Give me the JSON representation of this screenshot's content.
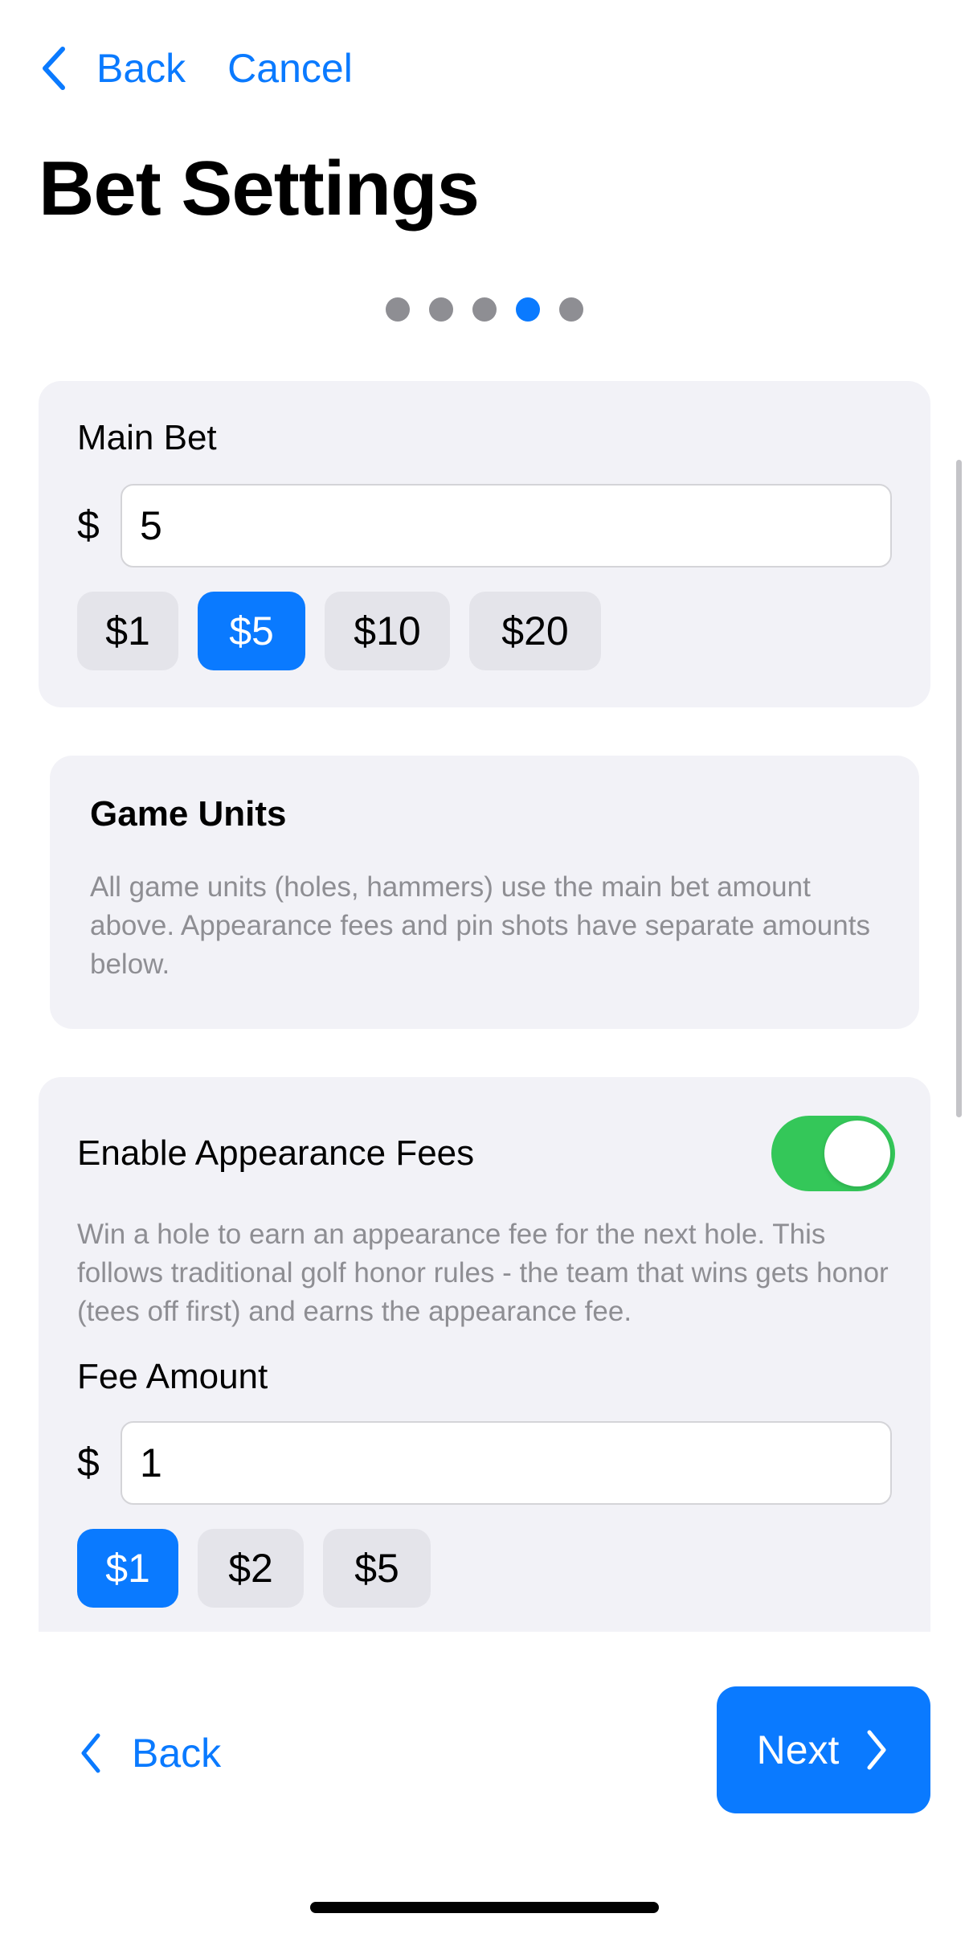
{
  "nav": {
    "back_label": "Back",
    "cancel_label": "Cancel"
  },
  "page": {
    "title": "Bet Settings"
  },
  "steps": {
    "count": 5,
    "active_index": 3
  },
  "main_bet": {
    "label": "Main Bet",
    "currency": "$",
    "value": "5",
    "presets": [
      {
        "label": "$1",
        "selected": false
      },
      {
        "label": "$5",
        "selected": true
      },
      {
        "label": "$10",
        "selected": false
      },
      {
        "label": "$20",
        "selected": false
      }
    ]
  },
  "game_units": {
    "title": "Game Units",
    "description": "All game units (holes, hammers) use the main bet amount above. Appearance fees and pin shots have separate amounts below."
  },
  "appearance_fees": {
    "toggle_label": "Enable Appearance Fees",
    "enabled": true,
    "description": "Win a hole to earn an appearance fee for the next hole. This follows traditional golf honor rules - the team that wins gets honor (tees off first) and earns the appearance fee.",
    "fee_label": "Fee Amount",
    "currency": "$",
    "value": "1",
    "presets": [
      {
        "label": "$1",
        "selected": true
      },
      {
        "label": "$2",
        "selected": false
      },
      {
        "label": "$5",
        "selected": false
      }
    ]
  },
  "footer": {
    "back_label": "Back",
    "next_label": "Next"
  },
  "colors": {
    "accent": "#0a7aff",
    "toggle_on": "#34c759",
    "card_bg": "#f2f2f7",
    "chip_bg": "#e4e4ea",
    "muted_text": "#8e8e93"
  }
}
